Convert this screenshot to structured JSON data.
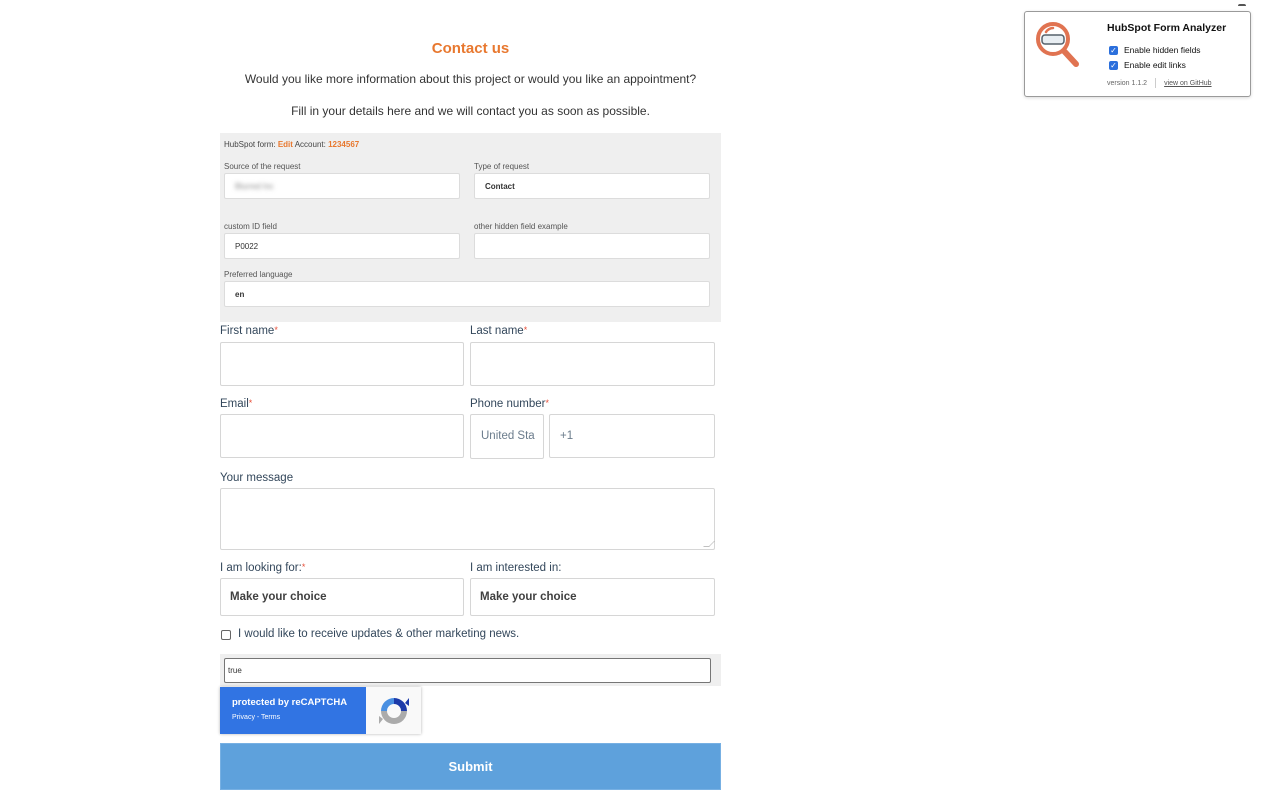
{
  "header": {
    "title": "Contact us",
    "intro_line1": "Would you like more information about this project or would you like an appointment?",
    "intro_line2": "Fill in your details here and we will contact you as soon as possible."
  },
  "hubspot_meta": {
    "prefix": "HubSpot form:",
    "edit_link": "Edit",
    "account_label": "Account:",
    "account_id": "1234567"
  },
  "hidden_fields": [
    {
      "label": "Source of the request",
      "value": "Blurred Inc"
    },
    {
      "label": "Type of request",
      "value": "Contact"
    },
    {
      "label": "custom ID field",
      "value": "P0022"
    },
    {
      "label": "other hidden field example",
      "value": ""
    },
    {
      "label": "Preferred language",
      "value": "en"
    }
  ],
  "form": {
    "first_name": {
      "label": "First name",
      "required_mark": "*",
      "value": ""
    },
    "last_name": {
      "label": "Last name",
      "required_mark": "*",
      "value": ""
    },
    "email": {
      "label": "Email",
      "required_mark": "*",
      "value": ""
    },
    "phone": {
      "label": "Phone number",
      "required_mark": "*",
      "country": "United Sta",
      "prefix": "+1"
    },
    "message": {
      "label": "Your message",
      "value": ""
    },
    "looking_for": {
      "label": "I am looking for:",
      "required_mark": "*",
      "selected": "Make your choice"
    },
    "interested_in": {
      "label": "I am interested in:",
      "selected": "Make your choice"
    },
    "marketing_opt_in": {
      "label": "I would like to receive updates & other marketing news.",
      "checked": false
    },
    "hidden_true_value": "true",
    "submit_label": "Submit"
  },
  "recaptcha": {
    "title": "protected by reCAPTCHA",
    "links": "Privacy - Terms"
  },
  "extension_popup": {
    "title": "HubSpot Form Analyzer",
    "options": [
      {
        "label": "Enable hidden fields",
        "checked": true
      },
      {
        "label": "Enable edit links",
        "checked": true
      }
    ],
    "version": "version 1.1.2",
    "github_link": "view on GitHub"
  },
  "colors": {
    "accent_orange": "#e8782f",
    "submit_blue": "#5ea1dc",
    "recaptcha_blue": "#3174e3",
    "required_red": "#e8503a"
  }
}
